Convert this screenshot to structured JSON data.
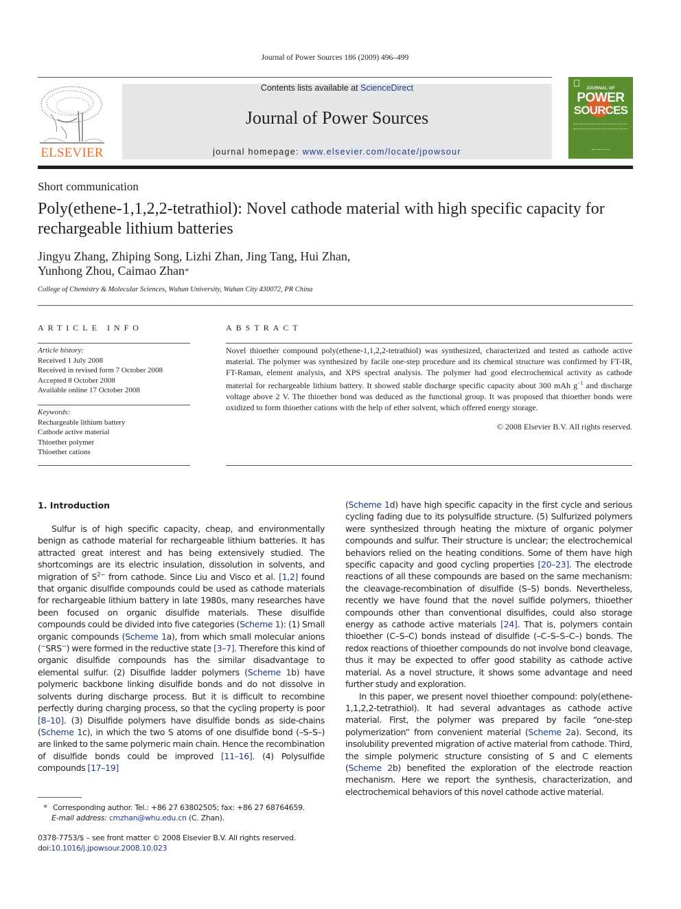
{
  "header": {
    "running_head": "Journal of Power Sources 186 (2009) 496–499",
    "publisher_logo_text": "ELSEVIER",
    "contents_prefix": "Contents lists available at ",
    "contents_link": "ScienceDirect",
    "journal_title": "Journal of Power Sources",
    "homepage_prefix": "journal homepage: ",
    "homepage_link": "www.elsevier.com/locate/jpowsour",
    "cover": {
      "line1": "JOURNAL OF",
      "line2": "POWER",
      "line3": "SOURCES",
      "bg_color": "#5b8e2f",
      "accent_color": "#d8602a"
    },
    "brand_color": "#f36f21",
    "link_color": "#1f3a8a"
  },
  "article": {
    "type": "Short communication",
    "title": "Poly(ethene-1,1,2,2-tetrathiol): Novel cathode material with high specific capacity for rechargeable lithium batteries",
    "authors_line1": "Jingyu Zhang, Zhiping Song, Lizhi Zhan, Jing Tang, Hui Zhan,",
    "authors_line2": "Yunhong Zhou, Caimao Zhan",
    "corresponding_mark": "*",
    "affiliation": "College of Chemistry & Molecular Sciences, Wuhan University, Wuhan City 430072, PR China"
  },
  "article_info": {
    "heading": "ARTICLE INFO",
    "history_label": "Article history:",
    "history": [
      "Received 1 July 2008",
      "Received in revised form 7 October 2008",
      "Accepted 8 October 2008",
      "Available online 17 October 2008"
    ],
    "keywords_label": "Keywords:",
    "keywords": [
      "Rechargeable lithium battery",
      "Cathode active material",
      "Thioether polymer",
      "Thioether cations"
    ]
  },
  "abstract": {
    "heading": "ABSTRACT",
    "text_part1": "Novel thioether compound poly(ethene-1,1,2,2-tetrathiol) was synthesized, characterized and tested as cathode active material. The polymer was synthesized by facile one-step procedure and its chemical structure was confirmed by FT-IR, FT-Raman, element analysis, and XPS spectral analysis. The polymer had good electrochemical activity as cathode material for rechargeable lithium battery. It showed stable discharge specific capacity about 300 mAh g",
    "text_sup": "−1",
    "text_part2": " and discharge voltage above 2 V. The thioether bond was deduced as the functional group. It was proposed that thioether bonds were oxidized to form thioether cations with the help of ether solvent, which offered energy storage.",
    "copyright": "© 2008 Elsevier B.V. All rights reserved."
  },
  "introduction": {
    "heading": "1.  Introduction",
    "left": {
      "p1_a": "Sulfur is of high specific capacity, cheap, and environmentally benign as cathode material for rechargeable lithium batteries. It has attracted great interest and has being extensively studied. The shortcomings are its electric insulation, dissolution in solvents, and migration of S",
      "p1_sup": "2−",
      "p1_b": " from cathode. Since Liu and Visco et al. ",
      "ref_1_2": "[1,2]",
      "p1_c": " found that organic disulfide compounds could be used as cathode materials for rechargeable lithium battery in late 1980s, many researches have been focused on organic disulfide materials. These disulfide compounds could be divided into five categories (",
      "scheme_1": "Scheme 1",
      "p1_d": "): (1) Small organic compounds (",
      "scheme_1a": "Scheme 1",
      "p1_e": "a), from which small molecular anions (",
      "anion_sup1": "−",
      "anion_mid": "SRS",
      "anion_sup2": "−",
      "p1_f": ") were formed in the reductive state ",
      "ref_3_7": "[3–7]",
      "p1_g": ". Therefore this kind of organic disulfide compounds has the similar disadvantage to elemental sulfur. (2) Disulfide ladder polymers (",
      "scheme_1b": "Scheme 1",
      "p1_h": "b) have polymeric backbone linking disulfide bonds and do not dissolve in solvents during discharge process. But it is difficult to recombine perfectly during charging process, so that the cycling property is poor ",
      "ref_8_10": "[8–10]",
      "p1_i": ". (3) Disulfide polymers have disulfide bonds as side-chains (",
      "scheme_1c": "Scheme 1",
      "p1_j": "c), in which the two S atoms of one disulfide bond (–S–S–) are linked to the same polymeric main chain. Hence the recombination of disulfide bonds could be improved ",
      "ref_11_16": "[11–16]",
      "p1_k": ". (4) Polysulfide compounds ",
      "ref_17_19": "[17–19]"
    },
    "right": {
      "p1_l_pre": "(",
      "scheme_1d": "Scheme 1",
      "p1_l": "d) have high specific capacity in the first cycle and serious cycling fading due to its polysulfide structure. (5) Sulfurized polymers were synthesized through heating the mixture of organic polymer compounds and sulfur. Their structure is unclear; the electrochemical behaviors relied on the heating conditions. Some of them have high specific capacity and good cycling properties ",
      "ref_20_23": "[20–23]",
      "p1_m": ". The electrode reactions of all these compounds are based on the same mechanism: the cleavage-recombination of disulfide (S–S) bonds. Nevertheless, recently we have found that the novel sulfide polymers, thioether compounds other than conventional disulfides, could also storage energy as cathode active materials ",
      "ref_24": "[24]",
      "p1_n": ". That is, polymers contain thioether (C–S–C) bonds instead of disulfide (–C–S–S–C–) bonds. The redox reactions of thioether compounds do not involve bond cleavage, thus it may be expected to offer good stability as cathode active material. As a novel structure, it shows some advantage and need further study and exploration.",
      "p2_a": "In this paper, we present novel thioether compound: poly(ethene-1,1,2,2-tetrathiol). It had several advantages as cathode active material. First, the polymer was prepared by facile “one-step polymerization” from convenient material (",
      "scheme_2a": "Scheme 2",
      "p2_b": "a). Second, its insolubility prevented migration of active material from cathode. Third, the simple polymeric structure consisting of S and C elements (",
      "scheme_2b": "Scheme 2",
      "p2_c": "b) benefited the exploration of the electrode reaction mechanism. Here we report the synthesis, characterization, and electrochemical behaviors of this novel cathode active material."
    }
  },
  "footnote": {
    "star": "*",
    "text": "Corresponding author. Tel.: +86 27 63802505; fax: +86 27 68764659.",
    "email_label": "E-mail address:",
    "email": "cmzhan@whu.edu.cn",
    "email_suffix": " (C. Zhan)."
  },
  "front_matter": {
    "issn_line": "0378-7753/$ – see front matter © 2008 Elsevier B.V. All rights reserved.",
    "doi_prefix": "doi:",
    "doi": "10.1016/j.jpowsour.2008.10.023"
  }
}
